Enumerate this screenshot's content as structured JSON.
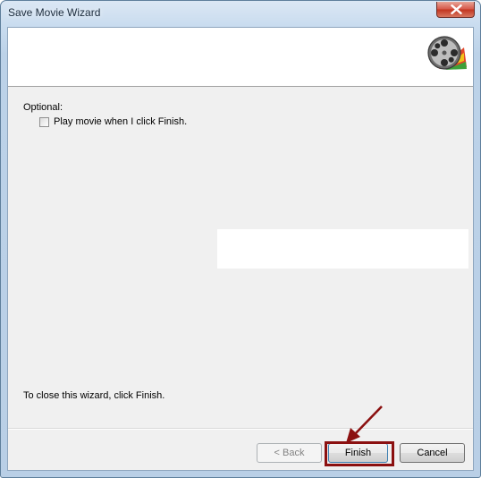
{
  "window": {
    "title": "Save Movie Wizard",
    "close_icon": "close-icon"
  },
  "header": {
    "icon": "movie-film-reel-icon"
  },
  "content": {
    "optional_label": "Optional:",
    "play_checkbox": {
      "label": "Play movie when I click Finish.",
      "checked": false
    },
    "close_hint": "To close this wizard, click Finish."
  },
  "buttons": {
    "back_label": "< Back",
    "back_enabled": false,
    "finish_label": "Finish",
    "cancel_label": "Cancel"
  },
  "annotation": {
    "highlight_color": "#8b1010",
    "target": "Finish"
  }
}
